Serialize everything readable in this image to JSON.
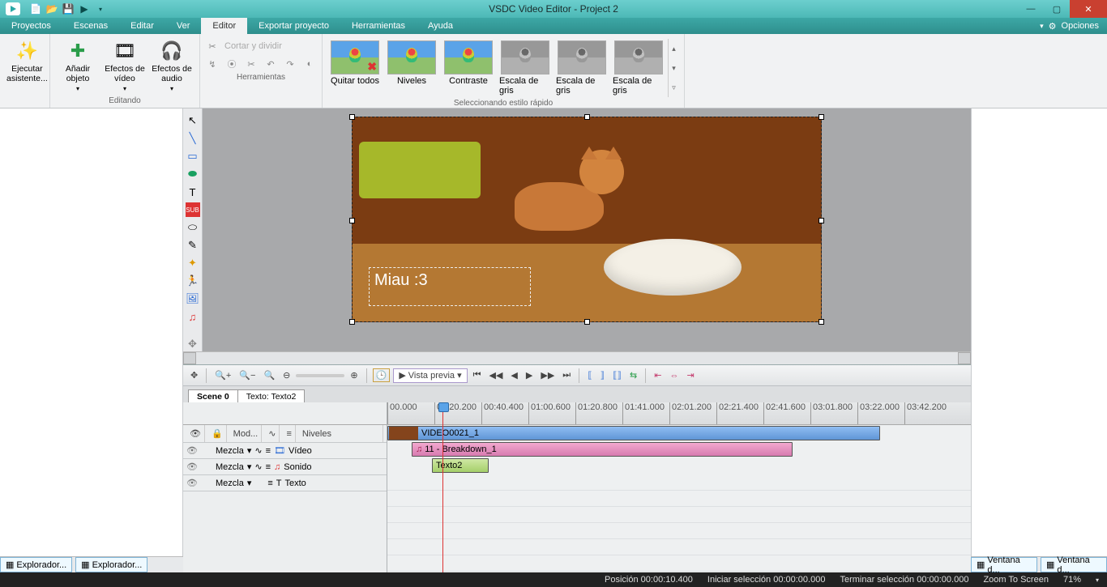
{
  "title": "VSDC Video Editor - Project 2",
  "menus": [
    "Proyectos",
    "Escenas",
    "Editar",
    "Ver",
    "Editor",
    "Exportar proyecto",
    "Herramientas",
    "Ayuda"
  ],
  "activeMenu": "Editor",
  "options": "Opciones",
  "ribbon": {
    "wizard": "Ejecutar asistente...",
    "addObj": "Añadir objeto",
    "videoFx": "Efectos de vídeo",
    "audioFx": "Efectos de audio",
    "editGroup": "Editando",
    "cut": "Cortar y dividir",
    "toolsGroup": "Herramientas",
    "styleGroup": "Seleccionando estilo rápido",
    "styles": [
      "Quitar todos",
      "Niveles",
      "Contraste",
      "Escala de gris",
      "Escala de gris",
      "Escala de gris"
    ]
  },
  "preview": {
    "overlayText": "Miau :3"
  },
  "timeline": {
    "tabs": [
      "Scene 0",
      "Texto: Texto2"
    ],
    "previewBtn": "Vista previa",
    "headerMode": "Mod...",
    "headerLevels": "Niveles",
    "mezcla": "Mezcla",
    "tracks": {
      "video": "Vídeo",
      "audio": "Sonido",
      "text": "Texto"
    },
    "clips": {
      "video": "VIDEO0021_1",
      "audio": "11 - Breakdown_1",
      "text": "Texto2"
    },
    "ticks": [
      "00.000",
      "00:20.200",
      "00:40.400",
      "01:00.600",
      "01:20.800",
      "01:41.000",
      "02:01.200",
      "02:21.400",
      "02:41.600",
      "03:01.800",
      "03:22.000",
      "03:42.200"
    ]
  },
  "panelTabs": {
    "left": [
      "Explorador...",
      "Explorador..."
    ],
    "right": [
      "Ventana d...",
      "Ventana d..."
    ]
  },
  "status": {
    "pos": "Posición   00:00:10.400",
    "selStart": "Iniciar selección   00:00:00.000",
    "selEnd": "Terminar selección   00:00:00.000",
    "zoom": "Zoom To Screen",
    "zoomPct": "71%"
  }
}
